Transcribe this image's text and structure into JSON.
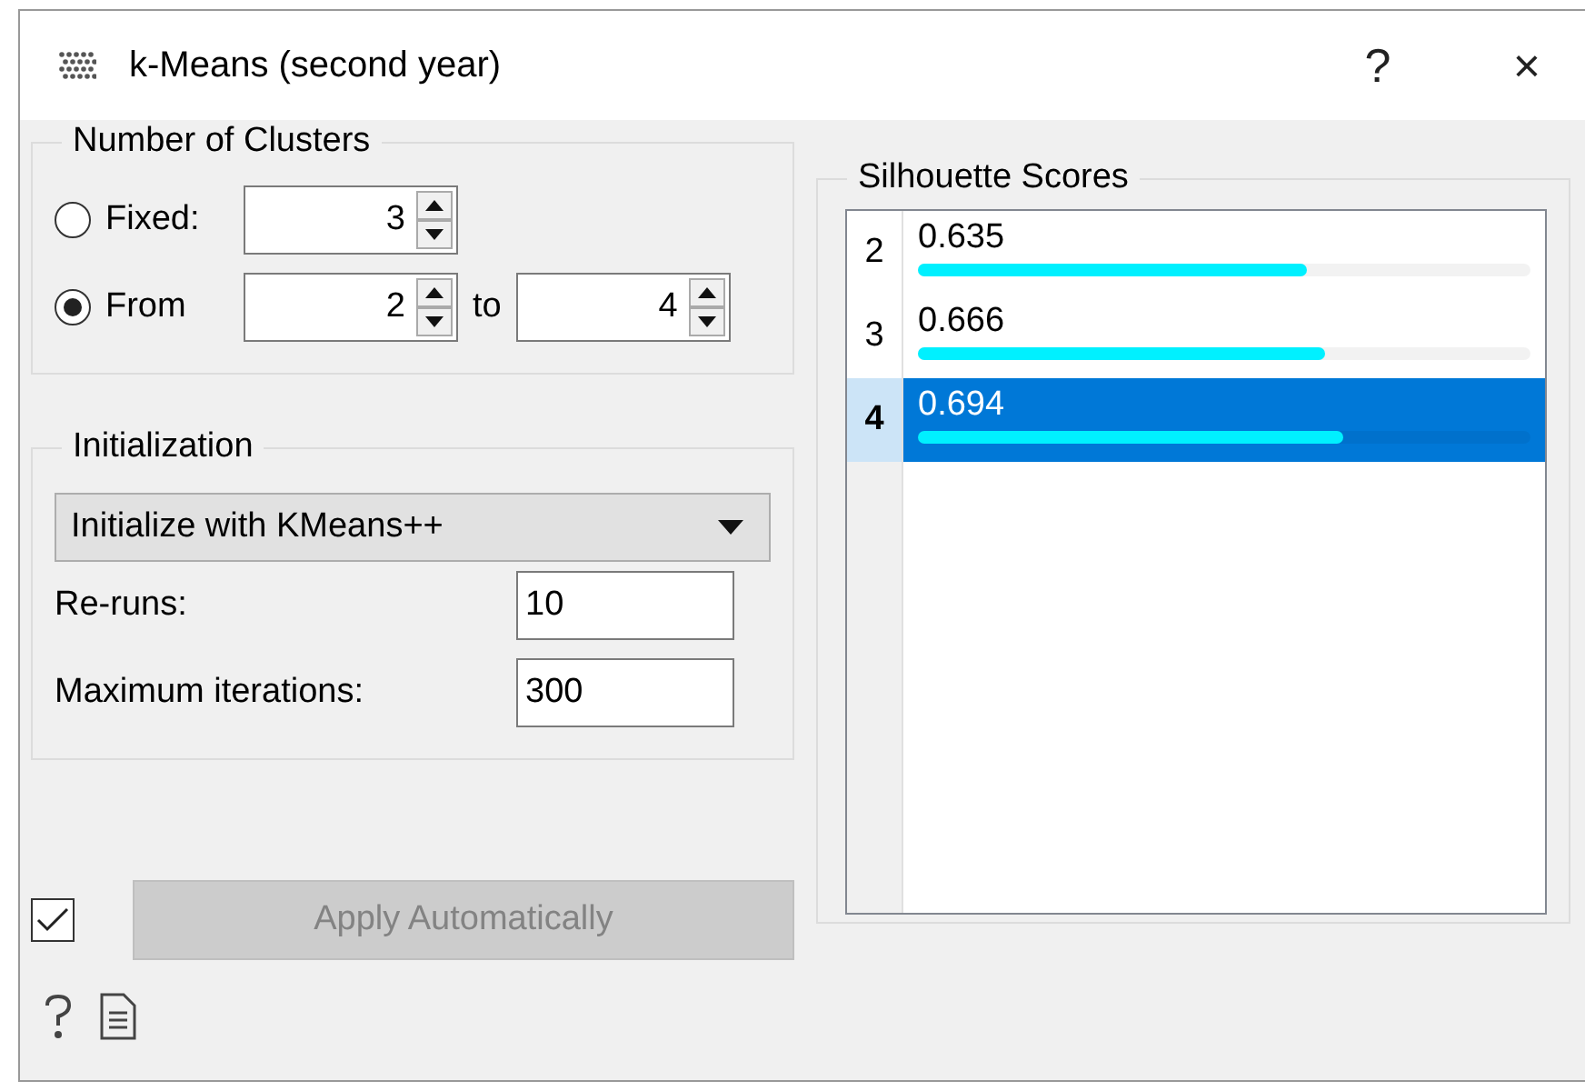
{
  "window": {
    "title": "k-Means (second year)",
    "help": "?",
    "close": "×"
  },
  "clusters": {
    "title": "Number of Clusters",
    "options": [
      {
        "label": "Fixed:",
        "selected": false
      },
      {
        "label": "From",
        "selected": true
      }
    ],
    "fixed_value": "3",
    "from_value": "2",
    "to_label": "to",
    "to_value": "4"
  },
  "initialization": {
    "title": "Initialization",
    "method": "Initialize with KMeans++",
    "fields": [
      {
        "label": "Re-runs:",
        "value": "10"
      },
      {
        "label": "Maximum iterations:",
        "value": "300"
      }
    ]
  },
  "apply": {
    "checked": true,
    "label": "Apply Automatically",
    "disabled": true
  },
  "scores": {
    "title": "Silhouette Scores",
    "rows": [
      {
        "k": "2",
        "score": "0.635",
        "level": 0.635,
        "selected": false
      },
      {
        "k": "3",
        "score": "0.666",
        "level": 0.666,
        "selected": false
      },
      {
        "k": "4",
        "score": "0.694",
        "level": 0.694,
        "selected": true
      }
    ]
  }
}
